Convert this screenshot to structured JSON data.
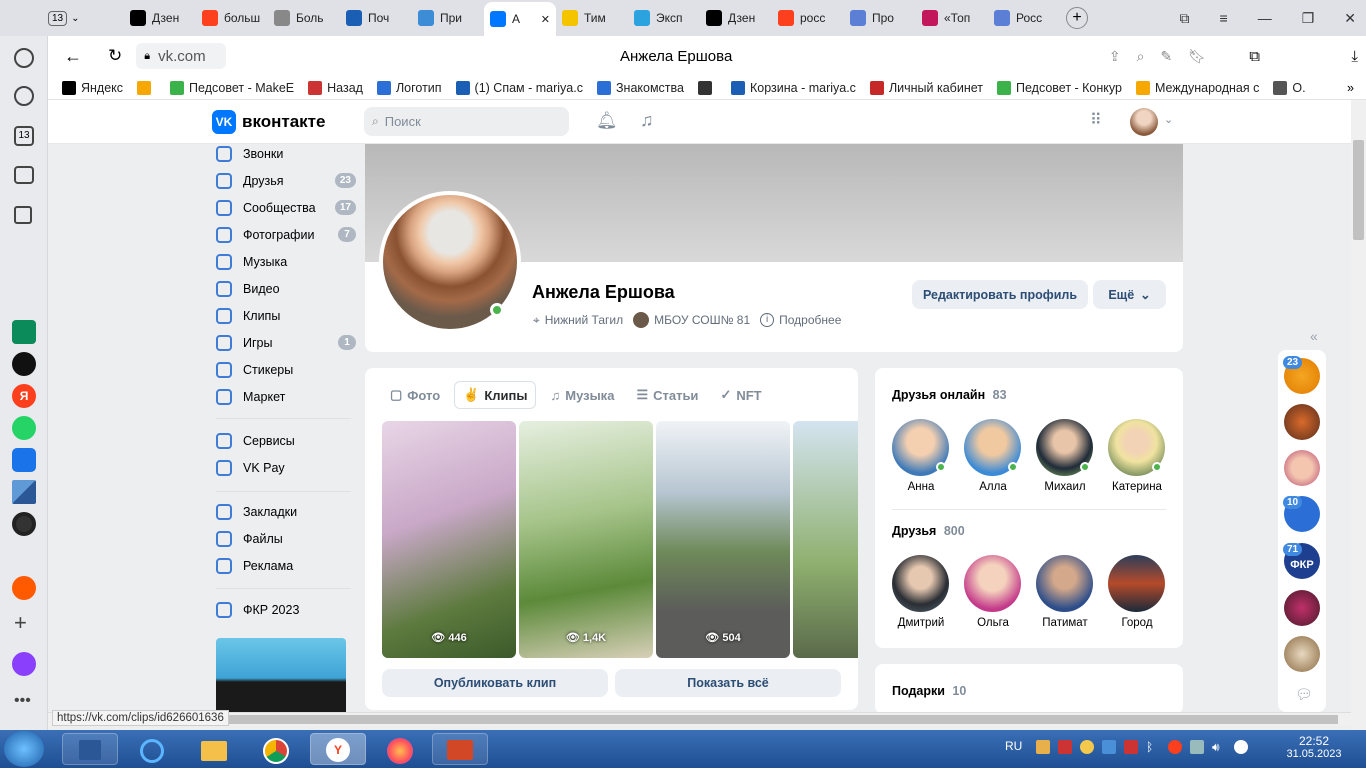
{
  "browser": {
    "tab_count": "13",
    "tabs": [
      {
        "label": "Дзен",
        "color": "#000"
      },
      {
        "label": "больш",
        "color": "#fc3f1d"
      },
      {
        "label": "Боль",
        "color": "#888"
      },
      {
        "label": "Поч",
        "color": "#1a5fb4"
      },
      {
        "label": "При",
        "color": "#3c8cd6"
      },
      {
        "label": "А",
        "color": "#0077ff"
      },
      {
        "label": "Тим",
        "color": "#f5c400"
      },
      {
        "label": "Эксп",
        "color": "#2aa3df"
      },
      {
        "label": "Дзен",
        "color": "#000"
      },
      {
        "label": "росс",
        "color": "#fc3f1d"
      },
      {
        "label": "Про",
        "color": "#5c7fd6"
      },
      {
        "label": "«Топ",
        "color": "#c2185b"
      },
      {
        "label": "Росс",
        "color": "#5c7fd6"
      }
    ],
    "address": "vk.com",
    "page_title": "Анжела Ершова",
    "bookmarks": [
      "Яндекс",
      "",
      "Педсовет - МakeE",
      "Назад",
      "Логотип",
      "(1) Спам - mariya.c",
      "Знакомства",
      "",
      "Корзина - mariya.c",
      "Личный кабинет",
      "Педсовет - Конкур",
      "Международная с",
      "О."
    ],
    "status_url": "https://vk.com/clips/id626601636"
  },
  "vk": {
    "logo": "вконтакте",
    "search_placeholder": "Поиск",
    "nav": [
      {
        "label": "Звонки",
        "count": ""
      },
      {
        "label": "Друзья",
        "count": "23"
      },
      {
        "label": "Сообщества",
        "count": "17"
      },
      {
        "label": "Фотографии",
        "count": "7"
      },
      {
        "label": "Музыка",
        "count": ""
      },
      {
        "label": "Видео",
        "count": ""
      },
      {
        "label": "Клипы",
        "count": ""
      },
      {
        "label": "Игры",
        "count": "1"
      },
      {
        "label": "Стикеры",
        "count": ""
      },
      {
        "label": "Маркет",
        "count": ""
      },
      {
        "label": "Сервисы",
        "count": ""
      },
      {
        "label": "VK Pay",
        "count": ""
      },
      {
        "label": "Закладки",
        "count": ""
      },
      {
        "label": "Файлы",
        "count": ""
      },
      {
        "label": "Реклама",
        "count": ""
      },
      {
        "label": "ФКР 2023",
        "count": ""
      }
    ],
    "profile": {
      "name": "Анжела Ершова",
      "city": "Нижний Тагил",
      "school": "МБОУ СОШ№ 81",
      "more": "Подробнее",
      "edit_button": "Редактировать профиль",
      "more_button": "Ещё"
    },
    "media_tabs": [
      "Фото",
      "Клипы",
      "Музыка",
      "Статьи",
      "NFT"
    ],
    "clips": [
      {
        "views": "446"
      },
      {
        "views": "1,4K"
      },
      {
        "views": "504"
      },
      {
        "views": ""
      }
    ],
    "publish_clip": "Опубликовать клип",
    "show_all": "Показать всё",
    "friends_online": {
      "title": "Друзья онлайн",
      "count": "83",
      "names": [
        "Анна",
        "Алла",
        "Михаил",
        "Катерина"
      ]
    },
    "friends": {
      "title": "Друзья",
      "count": "800",
      "names": [
        "Дмитрий",
        "Ольга",
        "Патимат",
        "Город"
      ]
    },
    "gifts": {
      "title": "Подарки",
      "count": "10"
    },
    "right_badges": [
      "23",
      "10",
      "71"
    ],
    "right_fkr": "ФКР"
  },
  "taskbar": {
    "lang": "RU",
    "time": "22:52",
    "date": "31.05.2023"
  }
}
